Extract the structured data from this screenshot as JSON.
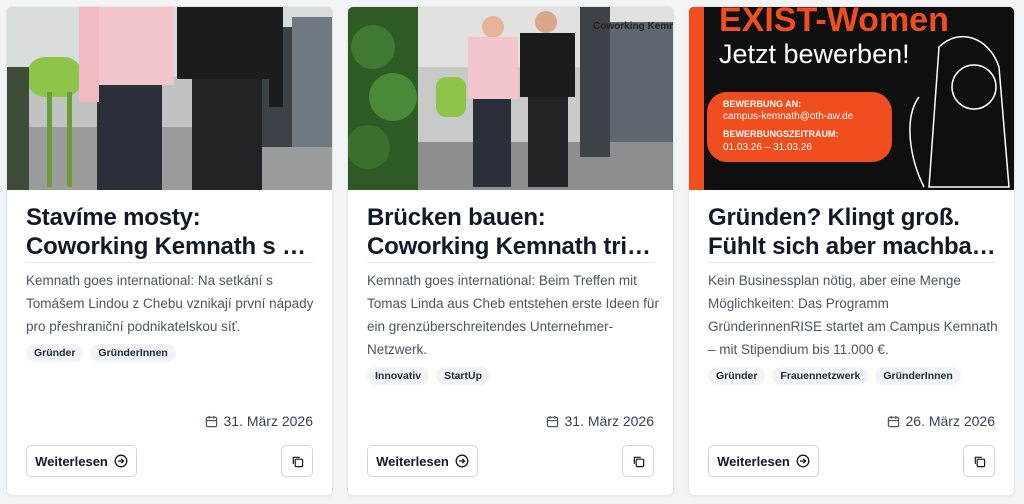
{
  "cards": [
    {
      "title_line1": "Stavíme mosty:",
      "title_line2": "Coworking Kemnath s Tomášem Lindou",
      "excerpt": "Kemnath goes international: Na setkání s Tomášem Lindou z Chebu vznikají první nápady pro přeshraniční podnikatelskou síť.",
      "tags": [
        "Gründer",
        "GründerInnen"
      ],
      "date": "31. März 2026",
      "read_more": "Weiterlesen",
      "image_icon": "photo-two-men-coworking"
    },
    {
      "title_line1": "Brücken bauen:",
      "title_line2": "Coworking Kemnath trifft Tomas Linda",
      "excerpt": "Kemnath goes international: Beim Treffen mit Tomas Linda aus Cheb entstehen erste Ideen für ein grenzüberschreitendes Unternehmer-Netzwerk.",
      "tags": [
        "Innovativ",
        "StartUp"
      ],
      "date": "31. März 2026",
      "read_more": "Weiterlesen",
      "image_icon": "photo-two-men-coworking-sign",
      "sign_text": "Coworking Kemnath"
    },
    {
      "title_line1": "Gründen? Klingt groß.",
      "title_line2": "Fühlt sich aber machbar an.",
      "excerpt": "Kein Businessplan nötig, aber eine Menge Möglichkeiten: Das Programm GründerinnenRISE startet am Campus Kemnath – mit Stipendium bis 11.000 €.",
      "tags": [
        "Gründer",
        "Frauennetzwerk",
        "GründerInnen"
      ],
      "date": "26. März 2026",
      "read_more": "Weiterlesen",
      "image_icon": "poster-exist-women",
      "poster": {
        "headline": "EXIST-Women",
        "subline": "Jetzt bewerben!",
        "label1": "BEWERBUNG AN:",
        "email": "campus-kemnath@oth-aw.de",
        "label2": "BEWERBUNGSZEITRAUM:",
        "period": "01.03.26 – 31.03.26"
      }
    }
  ],
  "colors": {
    "accent": "#f04e1f",
    "poster_bg": "#0f0f0f",
    "tag_bg": "#f1f3f6"
  }
}
